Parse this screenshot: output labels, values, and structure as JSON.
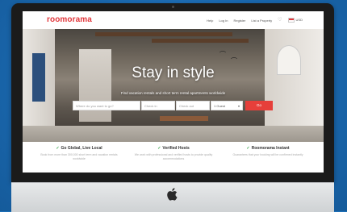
{
  "brand": {
    "logo_text": "roomorama",
    "accent": "#e2373b"
  },
  "nav": {
    "links": [
      "Help",
      "Log In",
      "Register",
      "List a Property"
    ],
    "heart_icon": "heart-icon",
    "currency": "USD"
  },
  "hero": {
    "title": "Stay in style",
    "subtitle": "Find vacation rentals and short term rental apartments worldwide"
  },
  "search": {
    "destination_placeholder": "Where do you want to go?",
    "checkin_placeholder": "Check in",
    "checkout_placeholder": "Check out",
    "guests_value": "1 Guest",
    "button_label": "Go"
  },
  "features": [
    {
      "title": "Go Global, Live Local",
      "desc": "Book from more than 300,000 short term and vacation rentals worldwide"
    },
    {
      "title": "Verified Hosts",
      "desc": "We work with professional and verified hosts to provide quality accommodations"
    },
    {
      "title": "Roomorama Instant",
      "desc": "Guarantees that your booking will be confirmed instantly"
    }
  ]
}
